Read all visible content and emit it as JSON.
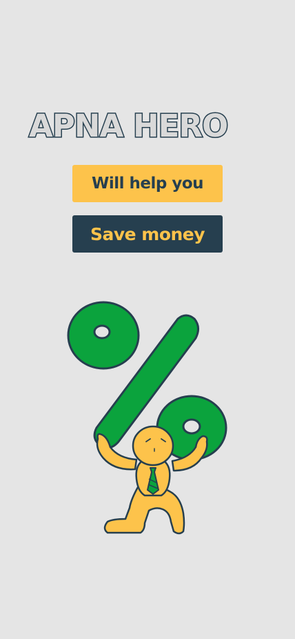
{
  "hero": {
    "title": "APNA HERO",
    "tagline_primary": "Will help you",
    "tagline_secondary": "Save money"
  },
  "illustration": {
    "icon": "person-lifting-percent-icon"
  },
  "colors": {
    "background": "#e5e5e5",
    "navy": "#263f4f",
    "yellow": "#fdc34b",
    "green": "#0ba33d"
  }
}
